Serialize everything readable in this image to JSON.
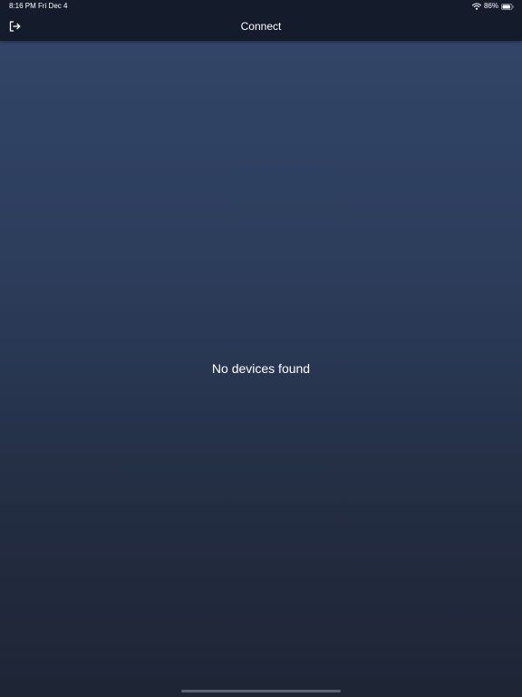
{
  "status_bar": {
    "time": "8:16 PM",
    "date": "Fri Dec 4",
    "battery_percent": "86%",
    "battery_level": 0.86,
    "wifi_icon": "wifi-icon",
    "battery_icon": "battery-icon"
  },
  "nav": {
    "title": "Connect",
    "logout_icon": "logout-icon"
  },
  "main": {
    "empty_message": "No devices found"
  },
  "colors": {
    "nav_background": "#141c2c",
    "gradient_top": "#33466a",
    "gradient_bottom": "#1e2535",
    "text": "#ffffff"
  }
}
